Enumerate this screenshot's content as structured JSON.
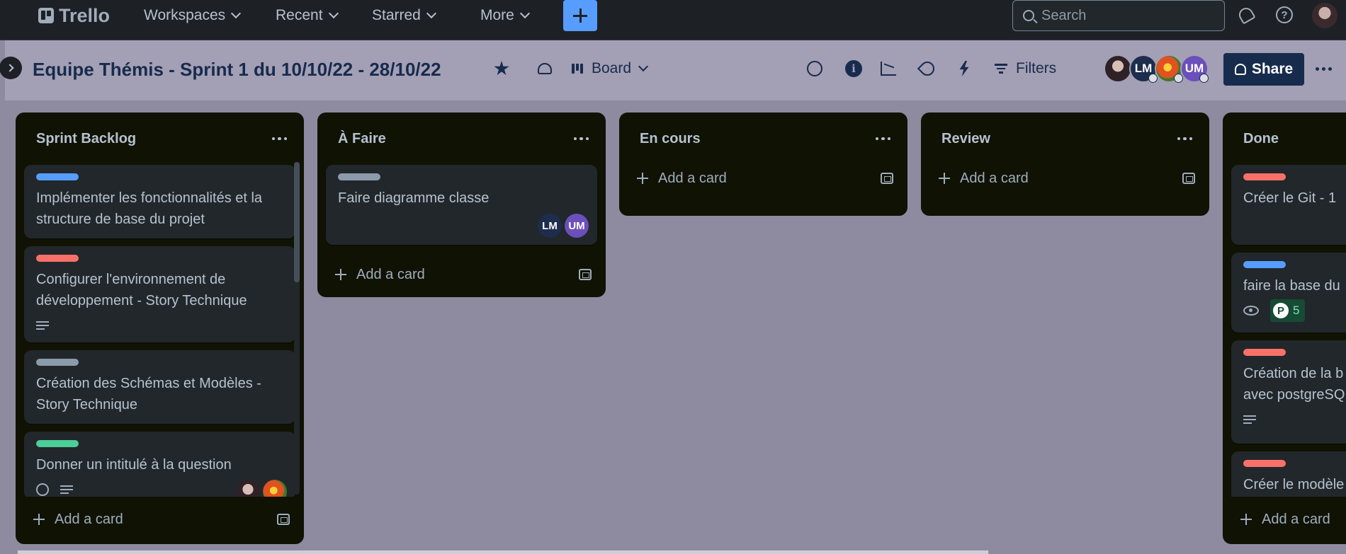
{
  "topnav": {
    "logo_text": "Trello",
    "menus": [
      "Workspaces",
      "Recent",
      "Starred",
      "More"
    ],
    "search_placeholder": "Search",
    "icons": [
      "apps-icon",
      "plus-icon",
      "search-icon",
      "bell-icon",
      "help-icon",
      "avatar"
    ]
  },
  "board": {
    "title": "Equipe Thémis - Sprint 1 du 10/10/22 - 28/10/22",
    "view_label": "Board",
    "filters_label": "Filters",
    "share_label": "Share",
    "members": [
      "LM",
      "UM"
    ]
  },
  "lists": [
    {
      "title": "Sprint Backlog",
      "add_label": "Add a card",
      "cards": [
        {
          "label_color": "#579dff",
          "title": "Implémenter les fonctionnalités et la structure de base du projet"
        },
        {
          "label_color": "#f87168",
          "title": "Configurer l'environnement de développement - Story Technique",
          "badge": "description"
        },
        {
          "label_color": "#8c9bab",
          "title": "Création des Schémas et Modèles - Story Technique"
        },
        {
          "label_color": "#4bce97",
          "title": "Donner un intitulé à la question"
        }
      ]
    },
    {
      "title": "À Faire",
      "add_label": "Add a card",
      "cards": [
        {
          "label_color": "#8c9bab",
          "title": "Faire diagramme classe",
          "members": [
            "LM",
            "UM"
          ]
        }
      ]
    },
    {
      "title": "En cours",
      "add_label": "Add a card",
      "cards": []
    },
    {
      "title": "Review",
      "add_label": "Add a card",
      "cards": []
    },
    {
      "title": "Done",
      "add_label": "Add a card",
      "cards": [
        {
          "label_color": "#f87168",
          "title": "Créer le Git - 1"
        },
        {
          "label_color": "#579dff",
          "title": "faire la base du",
          "points": "5"
        },
        {
          "label_color": "#f87168",
          "title": "Création de la b avec postgreSQ"
        },
        {
          "label_color": "#f87168",
          "title": "Créer le modèle"
        }
      ]
    }
  ]
}
